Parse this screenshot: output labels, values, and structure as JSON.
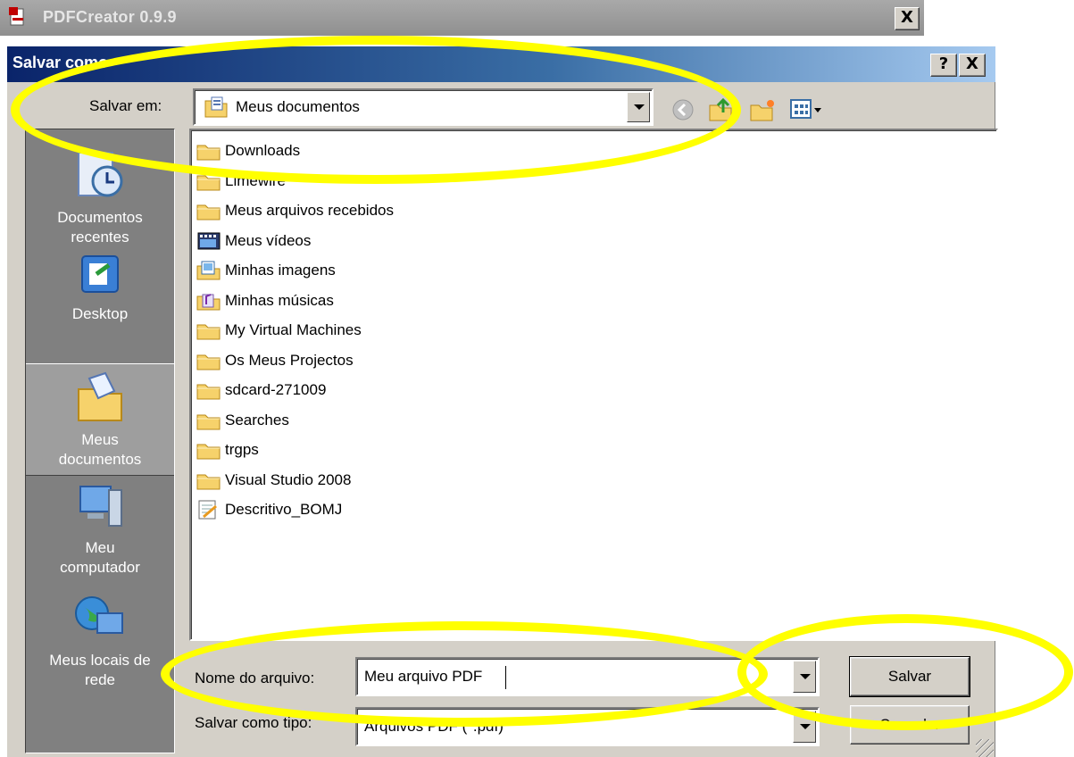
{
  "app_window": {
    "title": "PDFCreator 0.9.9",
    "close_label": "X"
  },
  "dialog": {
    "title": "Salvar como",
    "help_label": "?",
    "close_label": "X",
    "save_in": {
      "label": "Salvar em:",
      "value": "Meus documentos",
      "icon": "my-documents-icon"
    },
    "toolbar": [
      "back-icon",
      "up-folder-icon",
      "new-folder-icon",
      "view-menu-icon"
    ],
    "places": [
      {
        "label_lines": [
          "Documentos",
          "recentes"
        ],
        "icon": "recent-documents-icon",
        "active": false
      },
      {
        "label_lines": [
          "Desktop"
        ],
        "icon": "desktop-icon",
        "active": false
      },
      {
        "label_lines": [
          "Meus",
          "documentos"
        ],
        "icon": "my-documents-icon",
        "active": true
      },
      {
        "label_lines": [
          "Meu",
          "computador"
        ],
        "icon": "my-computer-icon",
        "active": false
      },
      {
        "label_lines": [
          "Meus locais de",
          "rede"
        ],
        "icon": "network-places-icon",
        "active": false
      }
    ],
    "files": [
      {
        "name": "Downloads",
        "icon": "folder-icon"
      },
      {
        "name": "Limewire",
        "icon": "folder-icon"
      },
      {
        "name": "Meus arquivos recebidos",
        "icon": "folder-icon"
      },
      {
        "name": "Meus vídeos",
        "icon": "video-folder-icon"
      },
      {
        "name": "Minhas imagens",
        "icon": "pictures-folder-icon"
      },
      {
        "name": "Minhas músicas",
        "icon": "music-folder-icon"
      },
      {
        "name": "My Virtual Machines",
        "icon": "folder-icon"
      },
      {
        "name": "Os Meus Projectos",
        "icon": "folder-icon"
      },
      {
        "name": "sdcard-271009",
        "icon": "folder-icon"
      },
      {
        "name": "Searches",
        "icon": "folder-icon"
      },
      {
        "name": "trgps",
        "icon": "folder-icon"
      },
      {
        "name": "Visual Studio 2008",
        "icon": "folder-icon"
      },
      {
        "name": "Descritivo_BOMJ",
        "icon": "document-icon"
      }
    ],
    "file_name": {
      "label": "Nome do arquivo:",
      "value": "Meu arquivo PDF"
    },
    "file_type": {
      "label": "Salvar como tipo:",
      "value": "Arquivos PDF (*.pdf)"
    },
    "save_button": "Salvar",
    "cancel_button": "Cancelar"
  },
  "colors": {
    "highlight": "#ffff00",
    "dialog_title_start": "#0a246a",
    "dialog_title_end": "#a6caf0",
    "face": "#d4d0c8",
    "places_bar": "#808080"
  }
}
